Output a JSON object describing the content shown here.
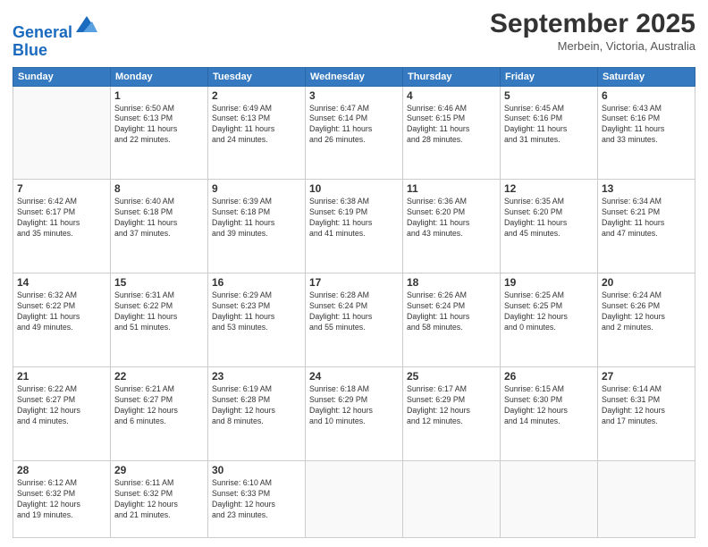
{
  "header": {
    "logo_line1": "General",
    "logo_line2": "Blue",
    "month": "September 2025",
    "location": "Merbein, Victoria, Australia"
  },
  "weekdays": [
    "Sunday",
    "Monday",
    "Tuesday",
    "Wednesday",
    "Thursday",
    "Friday",
    "Saturday"
  ],
  "weeks": [
    [
      {
        "day": "",
        "info": ""
      },
      {
        "day": "1",
        "info": "Sunrise: 6:50 AM\nSunset: 6:13 PM\nDaylight: 11 hours\nand 22 minutes."
      },
      {
        "day": "2",
        "info": "Sunrise: 6:49 AM\nSunset: 6:13 PM\nDaylight: 11 hours\nand 24 minutes."
      },
      {
        "day": "3",
        "info": "Sunrise: 6:47 AM\nSunset: 6:14 PM\nDaylight: 11 hours\nand 26 minutes."
      },
      {
        "day": "4",
        "info": "Sunrise: 6:46 AM\nSunset: 6:15 PM\nDaylight: 11 hours\nand 28 minutes."
      },
      {
        "day": "5",
        "info": "Sunrise: 6:45 AM\nSunset: 6:16 PM\nDaylight: 11 hours\nand 31 minutes."
      },
      {
        "day": "6",
        "info": "Sunrise: 6:43 AM\nSunset: 6:16 PM\nDaylight: 11 hours\nand 33 minutes."
      }
    ],
    [
      {
        "day": "7",
        "info": "Sunrise: 6:42 AM\nSunset: 6:17 PM\nDaylight: 11 hours\nand 35 minutes."
      },
      {
        "day": "8",
        "info": "Sunrise: 6:40 AM\nSunset: 6:18 PM\nDaylight: 11 hours\nand 37 minutes."
      },
      {
        "day": "9",
        "info": "Sunrise: 6:39 AM\nSunset: 6:18 PM\nDaylight: 11 hours\nand 39 minutes."
      },
      {
        "day": "10",
        "info": "Sunrise: 6:38 AM\nSunset: 6:19 PM\nDaylight: 11 hours\nand 41 minutes."
      },
      {
        "day": "11",
        "info": "Sunrise: 6:36 AM\nSunset: 6:20 PM\nDaylight: 11 hours\nand 43 minutes."
      },
      {
        "day": "12",
        "info": "Sunrise: 6:35 AM\nSunset: 6:20 PM\nDaylight: 11 hours\nand 45 minutes."
      },
      {
        "day": "13",
        "info": "Sunrise: 6:34 AM\nSunset: 6:21 PM\nDaylight: 11 hours\nand 47 minutes."
      }
    ],
    [
      {
        "day": "14",
        "info": "Sunrise: 6:32 AM\nSunset: 6:22 PM\nDaylight: 11 hours\nand 49 minutes."
      },
      {
        "day": "15",
        "info": "Sunrise: 6:31 AM\nSunset: 6:22 PM\nDaylight: 11 hours\nand 51 minutes."
      },
      {
        "day": "16",
        "info": "Sunrise: 6:29 AM\nSunset: 6:23 PM\nDaylight: 11 hours\nand 53 minutes."
      },
      {
        "day": "17",
        "info": "Sunrise: 6:28 AM\nSunset: 6:24 PM\nDaylight: 11 hours\nand 55 minutes."
      },
      {
        "day": "18",
        "info": "Sunrise: 6:26 AM\nSunset: 6:24 PM\nDaylight: 11 hours\nand 58 minutes."
      },
      {
        "day": "19",
        "info": "Sunrise: 6:25 AM\nSunset: 6:25 PM\nDaylight: 12 hours\nand 0 minutes."
      },
      {
        "day": "20",
        "info": "Sunrise: 6:24 AM\nSunset: 6:26 PM\nDaylight: 12 hours\nand 2 minutes."
      }
    ],
    [
      {
        "day": "21",
        "info": "Sunrise: 6:22 AM\nSunset: 6:27 PM\nDaylight: 12 hours\nand 4 minutes."
      },
      {
        "day": "22",
        "info": "Sunrise: 6:21 AM\nSunset: 6:27 PM\nDaylight: 12 hours\nand 6 minutes."
      },
      {
        "day": "23",
        "info": "Sunrise: 6:19 AM\nSunset: 6:28 PM\nDaylight: 12 hours\nand 8 minutes."
      },
      {
        "day": "24",
        "info": "Sunrise: 6:18 AM\nSunset: 6:29 PM\nDaylight: 12 hours\nand 10 minutes."
      },
      {
        "day": "25",
        "info": "Sunrise: 6:17 AM\nSunset: 6:29 PM\nDaylight: 12 hours\nand 12 minutes."
      },
      {
        "day": "26",
        "info": "Sunrise: 6:15 AM\nSunset: 6:30 PM\nDaylight: 12 hours\nand 14 minutes."
      },
      {
        "day": "27",
        "info": "Sunrise: 6:14 AM\nSunset: 6:31 PM\nDaylight: 12 hours\nand 17 minutes."
      }
    ],
    [
      {
        "day": "28",
        "info": "Sunrise: 6:12 AM\nSunset: 6:32 PM\nDaylight: 12 hours\nand 19 minutes."
      },
      {
        "day": "29",
        "info": "Sunrise: 6:11 AM\nSunset: 6:32 PM\nDaylight: 12 hours\nand 21 minutes."
      },
      {
        "day": "30",
        "info": "Sunrise: 6:10 AM\nSunset: 6:33 PM\nDaylight: 12 hours\nand 23 minutes."
      },
      {
        "day": "",
        "info": ""
      },
      {
        "day": "",
        "info": ""
      },
      {
        "day": "",
        "info": ""
      },
      {
        "day": "",
        "info": ""
      }
    ]
  ]
}
